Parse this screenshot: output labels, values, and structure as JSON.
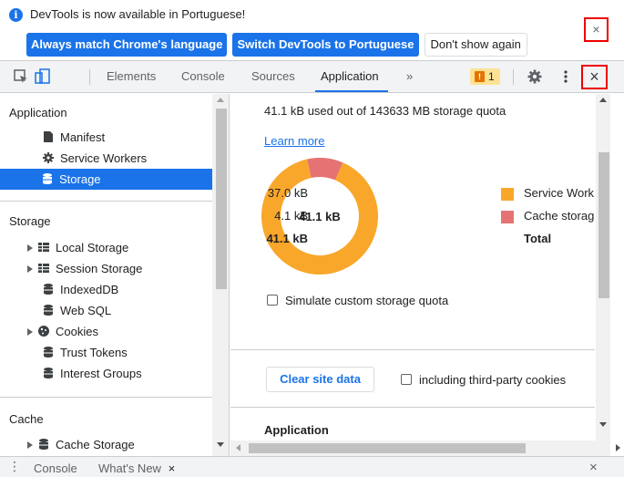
{
  "infobar": {
    "message": "DevTools is now available in Portuguese!",
    "info_icon": "i",
    "btn_match": "Always match Chrome's language",
    "btn_switch": "Switch DevTools to Portuguese",
    "btn_dont_show": "Don't show again",
    "close_glyph": "×"
  },
  "tabs": {
    "items": [
      "Elements",
      "Console",
      "Sources",
      "Application"
    ],
    "overflow": "»",
    "active": "Application",
    "issues_count": "1",
    "issues_glyph": "!",
    "close_glyph": "×"
  },
  "sidebar": {
    "app_header": "Application",
    "app_items": [
      "Manifest",
      "Service Workers",
      "Storage"
    ],
    "storage_header": "Storage",
    "storage_items": [
      "Local Storage",
      "Session Storage",
      "IndexedDB",
      "Web SQL",
      "Cookies",
      "Trust Tokens",
      "Interest Groups"
    ],
    "cache_header": "Cache",
    "cache_items": [
      "Cache Storage"
    ]
  },
  "main": {
    "quota_text": "41.1 kB used out of 143633 MB storage quota",
    "learn_more": "Learn more",
    "simulate_label": "Simulate custom storage quota",
    "clear_button": "Clear site data",
    "third_party_label": "including third-party cookies",
    "application_header": "Application"
  },
  "chart_data": {
    "type": "pie",
    "center_label": "41.1 kB",
    "categories": [
      "Service Workers",
      "Cache storage"
    ],
    "values": [
      37.0,
      4.1
    ],
    "value_labels": [
      "37.0 kB",
      "4.1 kB"
    ],
    "legend_names": [
      "Service Work",
      "Cache storag"
    ],
    "colors": [
      "#f9a72b",
      "#e57373"
    ],
    "total_value": "41.1 kB",
    "total_label": "Total"
  },
  "drawer": {
    "tabs": [
      "Console",
      "What's New"
    ],
    "menu_glyph": "⋮",
    "tab_close_glyph": "×",
    "close_glyph": "×"
  }
}
